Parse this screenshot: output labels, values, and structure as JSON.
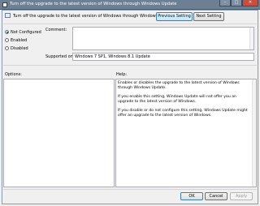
{
  "window": {
    "title": "Turn off the upgrade to the latest version of Windows through Windows Update",
    "controls": {
      "minimize": "–",
      "maximize": "□",
      "close": "✕"
    }
  },
  "header": {
    "policy_title": "Turn off the upgrade to the latest version of Windows through Windows Update",
    "previous_label": "Previous Setting",
    "next_label": "Next Setting"
  },
  "state": {
    "options": [
      {
        "label": "Not Configured",
        "selected": true
      },
      {
        "label": "Enabled",
        "selected": false
      },
      {
        "label": "Disabled",
        "selected": false
      }
    ]
  },
  "comment": {
    "label": "Comment:",
    "value": ""
  },
  "supported": {
    "label": "Supported on:",
    "value": "Windows 7 SP1, Windows 8.1 Update"
  },
  "panes": {
    "options_label": "Options:",
    "help_label": "Help:",
    "help_paragraphs": [
      "Enables or disables the upgrade to the latest version of Windows through Windows Update.",
      "If you enable this setting, Windows Update will not offer you an upgrade to the latest version of Windows.",
      "If you disable or do not configure this setting, Windows Update might offer an upgrade to the latest version of Windows."
    ]
  },
  "footer": {
    "ok_label": "OK",
    "cancel_label": "Cancel",
    "apply_label": "Apply"
  },
  "colors": {
    "titlebar": "#6d7f93",
    "dialog_bg": "#f0f0f0",
    "accent": "#3c7fb1"
  }
}
